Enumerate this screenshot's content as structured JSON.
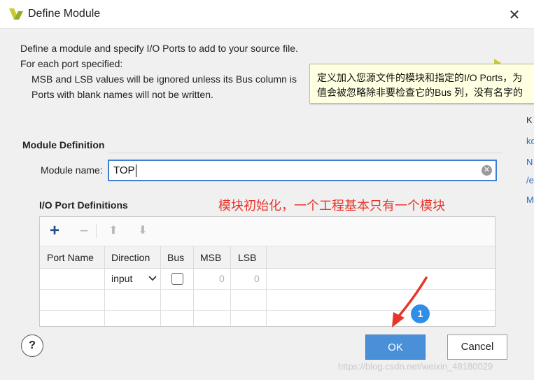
{
  "window": {
    "title": "Define Module",
    "close_glyph": "✕"
  },
  "description": {
    "line1": "Define a module and specify I/O Ports to add to your source file.",
    "line2": "For each port specified:",
    "line3": "MSB and LSB values will be ignored unless its Bus column is",
    "line4": "Ports with blank names will not be written."
  },
  "tooltip": {
    "line1": "定义加入您源文件的模块和指定的I/O Ports，为",
    "line2": "值会被忽略除非要检查它的Bus 列，没有名字的"
  },
  "right_strip": [
    "K",
    "ko",
    "N",
    "/e",
    "M"
  ],
  "module_definition": {
    "section_title": "Module Definition",
    "name_label": "Module name:",
    "name_value": "TOP"
  },
  "annotation": "模块初始化，一个工程基本只有一个模块",
  "io_ports": {
    "section_title": "I/O Port Definitions",
    "toolbar": {
      "add": "+",
      "remove": "−",
      "up": "⬆",
      "down": "⬇"
    },
    "columns": [
      "Port Name",
      "Direction",
      "Bus",
      "MSB",
      "LSB"
    ],
    "rows": [
      {
        "port_name": "",
        "direction": "input",
        "bus": false,
        "msb": "0",
        "lsb": "0"
      }
    ]
  },
  "buttons": {
    "help": "?",
    "ok": "OK",
    "cancel": "Cancel"
  },
  "badge": "1",
  "watermark": "https://blog.csdn.net/weixin_48180029",
  "colors": {
    "accent": "#4a90d9",
    "annotation": "#e8352b",
    "tooltip_bg": "#ffffe1",
    "badge": "#2f8fe8"
  }
}
